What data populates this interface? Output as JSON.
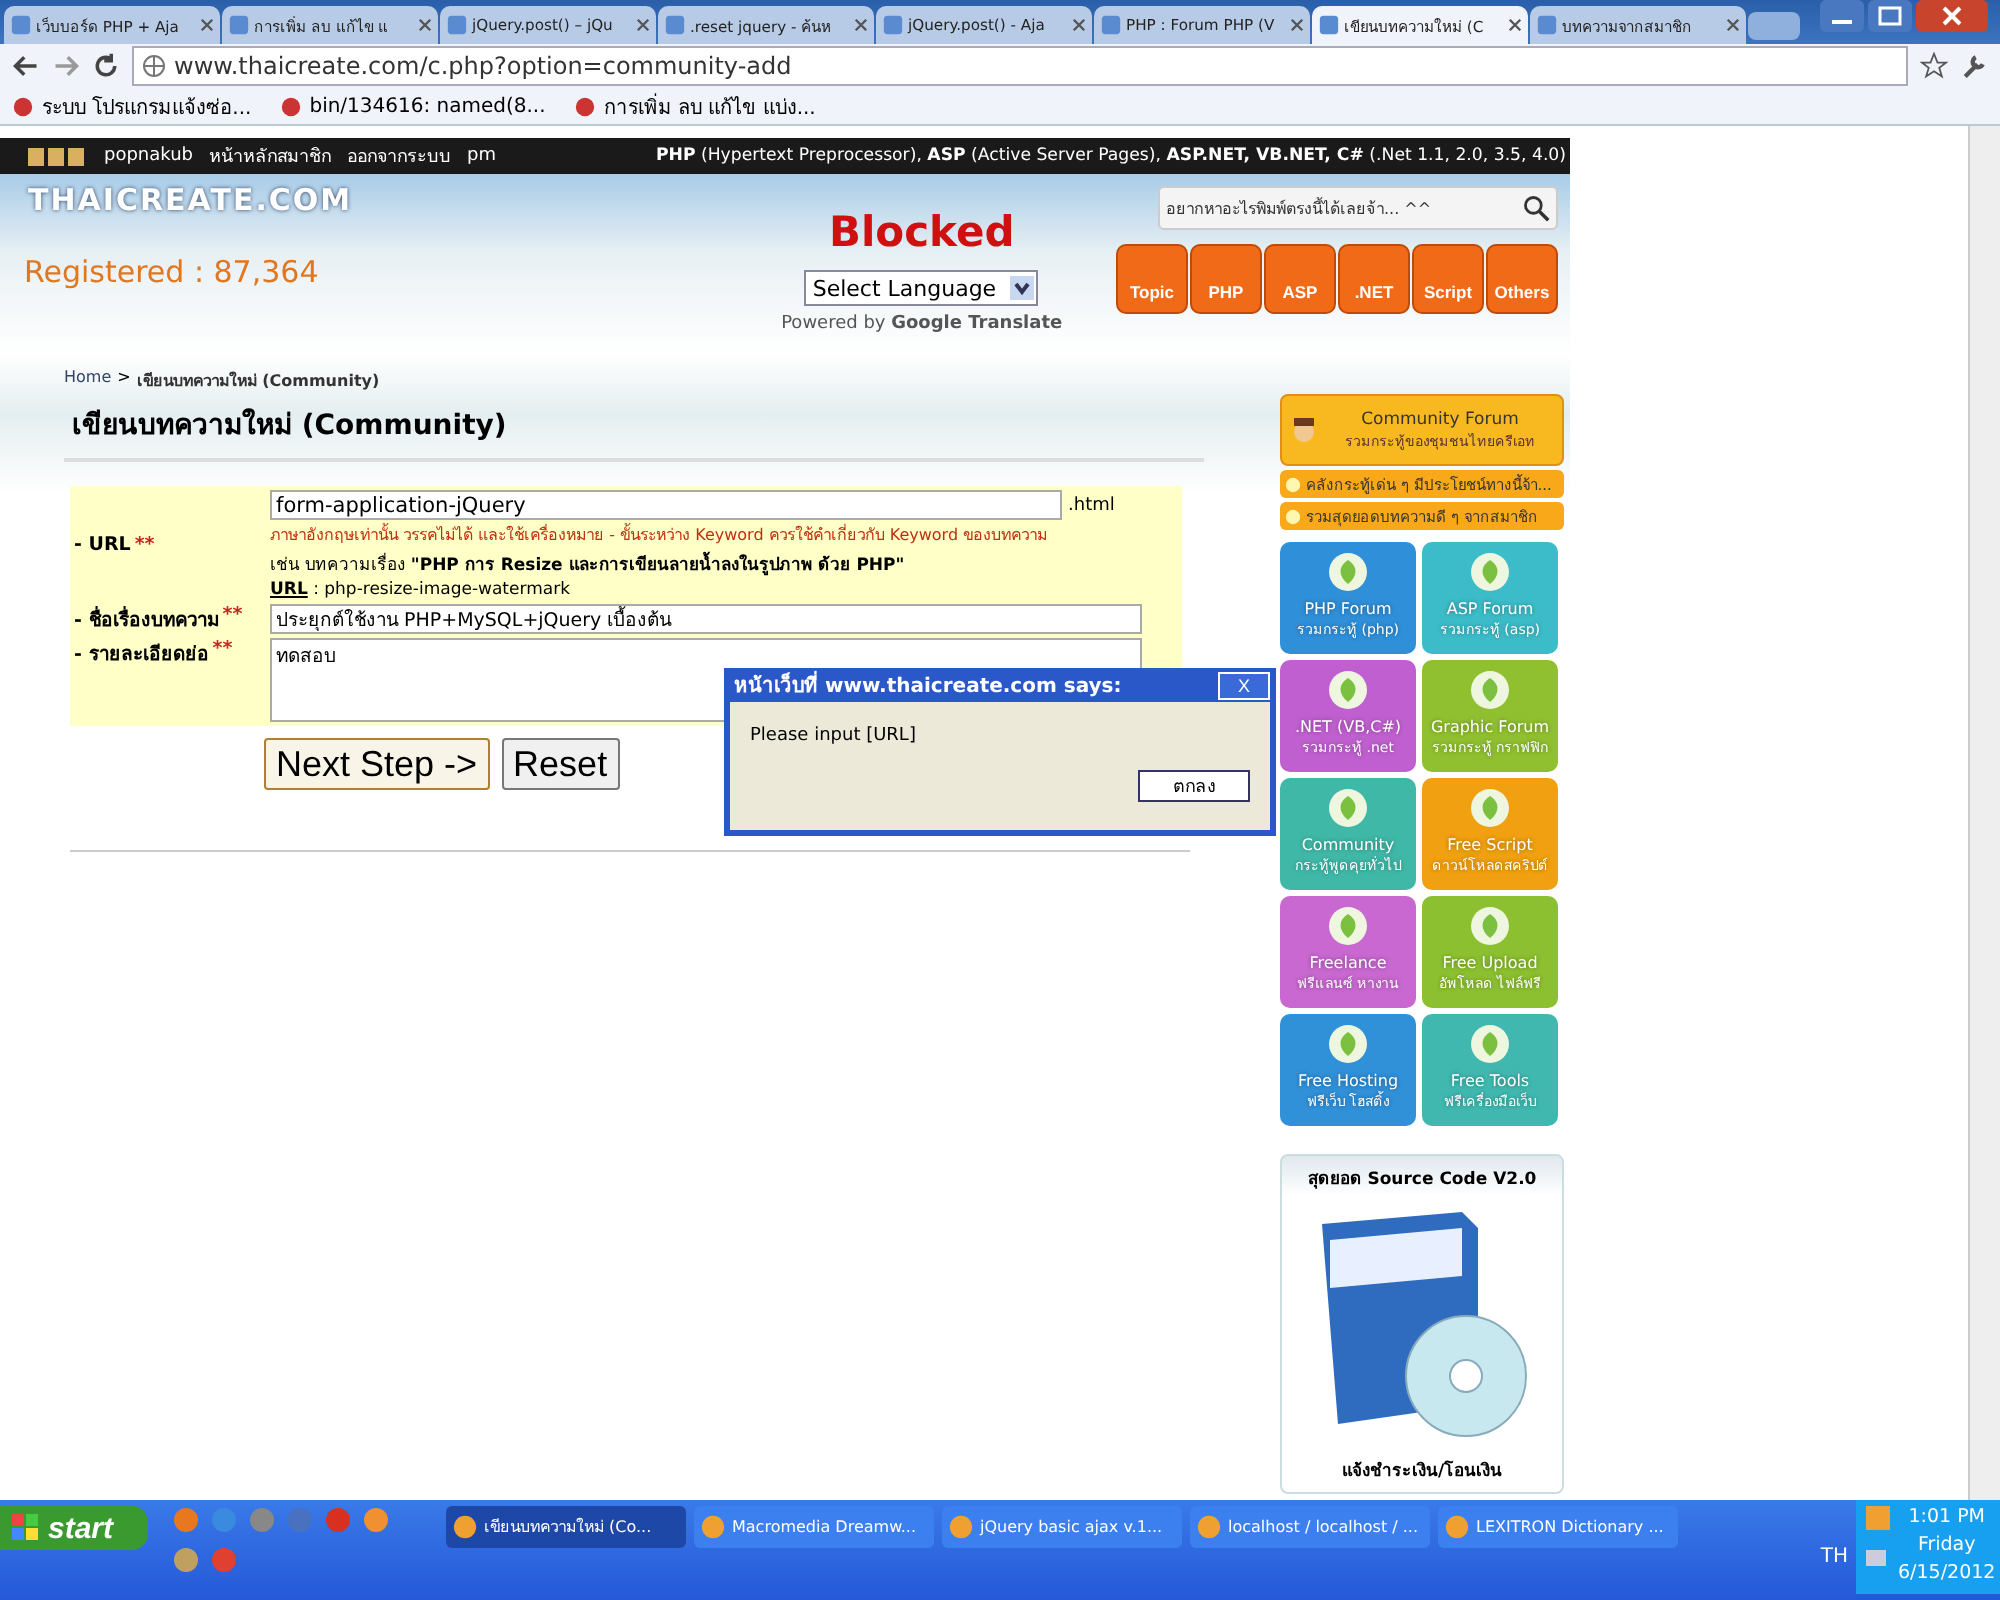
{
  "browser": {
    "tabs": [
      {
        "title": "เว็บบอร์ด PHP + Aja",
        "selected": false
      },
      {
        "title": "การเพิ่ม ลบ แก้ไข แ",
        "selected": false
      },
      {
        "title": "jQuery.post() – jQu",
        "selected": false
      },
      {
        "title": ".reset jquery - ค้นห",
        "selected": false
      },
      {
        "title": "jQuery.post() - Aja",
        "selected": false
      },
      {
        "title": "PHP : Forum PHP (V",
        "selected": false
      },
      {
        "title": "เขียนบทความใหม่ (C",
        "selected": true
      },
      {
        "title": "บทความจากสมาชิก",
        "selected": false
      }
    ],
    "address": "www.thaicreate.com/c.php?option=community-add",
    "bookmarks": [
      "ระบบ โปรแกรมแจ้งซ่อ...",
      "bin/134616: named(8...",
      "การเพิ่ม ลบ แก้ไข แบ่ง..."
    ]
  },
  "top_bar": {
    "user": "popnakub",
    "member_home": "หน้าหลักสมาชิก",
    "logout": "ออกจากระบบ",
    "pm": "pm",
    "tagline": "**PHP** (Hypertext Preprocessor), **ASP** (Active Server Pages), **ASP.NET, VB.NET, C#** (.Net 1.1, 2.0, 3.5, 4.0)"
  },
  "header": {
    "logo": "THAICREATE.COM",
    "registered": "Registered : 87,364",
    "blocked": "Blocked",
    "language_select": "Select Language",
    "powered_by": "Powered by **Google Translate**",
    "search_placeholder": "อยากหาอะไรพิมพ์ตรงนี้ได้เลยจ้า... ^^",
    "nav": [
      "Topic",
      "PHP",
      "ASP",
      ".NET",
      "Script",
      "Others"
    ]
  },
  "page": {
    "breadcrumb": {
      "home": "Home",
      "separator": ">",
      "current": "เขียนบทความใหม่ (Community)"
    },
    "heading": "เขียนบทความใหม่ (Community)",
    "form": {
      "url": {
        "label": "- URL",
        "required": "**",
        "value": "form-application-jQuery",
        "suffix": ".html",
        "hint": "ภาษาอังกฤษเท่านั้น วรรคไม่ได้ และใช้เครื่องหมาย - ขั้นระหว่าง Keyword ควรใช้คำเกี่ยวกับ Keyword ของบทความ",
        "example": "เช่น บทความเรื่อง **\"PHP การ Resize และการเขียนลายน้ำลงในรูปภาพ ด้วย PHP\"**",
        "example_url_label": "URL",
        "example_url_value": ": php-resize-image-watermark"
      },
      "title": {
        "label": "- ชื่อเรื่องบทความ",
        "required": "**",
        "value": "ประยุกต์ใช้งาน PHP+MySQL+jQuery เบื้องต้น"
      },
      "summary": {
        "label": "- รายละเอียดย่อ",
        "required": "**",
        "value": "ทดสอบ"
      }
    },
    "buttons": [
      "Next Step ->",
      "Reset"
    ]
  },
  "sidebar": {
    "community": {
      "title": "Community Forum",
      "subtitle": "รวมกระทู้ของชุมชนไทยครีเอท"
    },
    "links": [
      "คลังกระทู้เด่น ๆ มีประโยชน์ทางนี้จ้า...",
      "รวมสุดยอดบทความดี ๆ จากสมาชิก"
    ],
    "tiles": [
      {
        "title": "PHP Forum",
        "subtitle": "รวมกระทู้ (php)",
        "color": "#2f8fd8"
      },
      {
        "title": "ASP Forum",
        "subtitle": "รวมกระทู้ (asp)",
        "color": "#3cbcc8"
      },
      {
        "title": ".NET (VB,C#)",
        "subtitle": "รวมกระทู้ .net",
        "color": "#c060d0"
      },
      {
        "title": "Graphic Forum",
        "subtitle": "รวมกระทู้ กราฟฟิก",
        "color": "#90c030"
      },
      {
        "title": "Community",
        "subtitle": "กระทู้พูดคุยทั่วไป",
        "color": "#40b8a8"
      },
      {
        "title": "Free Script",
        "subtitle": "ดาวน์โหลดสคริปต์",
        "color": "#f0a010"
      },
      {
        "title": "Freelance",
        "subtitle": "ฟรีแลนซ์ หางาน",
        "color": "#c868d0"
      },
      {
        "title": "Free Upload",
        "subtitle": "อัพโหลด ไฟล์ฟรี",
        "color": "#8cc030"
      },
      {
        "title": "Free Hosting",
        "subtitle": "ฟรีเว็บ โฮสติ้ง",
        "color": "#3090d8"
      },
      {
        "title": "Free Tools",
        "subtitle": "ฟรีเครื่องมือเว็บ",
        "color": "#40b8b0"
      }
    ],
    "source_code": {
      "title": "สุดยอด Source Code V2.0",
      "caption": "แจ้งชำระเงิน/โอนเงิน"
    }
  },
  "dialog": {
    "title": "หน้าเว็บที่ www.thaicreate.com says:",
    "close": "X",
    "message": "Please input [URL]",
    "button": "ตกลง"
  },
  "taskbar": {
    "start": "start",
    "tasks": [
      {
        "label": "เขียนบทความใหม่ (Co...",
        "selected": true
      },
      {
        "label": "Macromedia Dreamw...",
        "selected": false
      },
      {
        "label": "jQuery basic ajax v.1...",
        "selected": false
      },
      {
        "label": "localhost / localhost / ...",
        "selected": false
      },
      {
        "label": "LEXITRON Dictionary ...",
        "selected": false
      }
    ],
    "language": "TH",
    "time": "1:01 PM",
    "day": "Friday",
    "date": "6/15/2012"
  }
}
